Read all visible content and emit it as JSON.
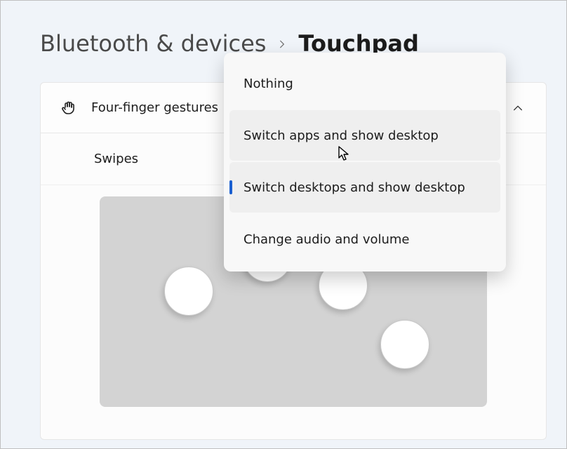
{
  "breadcrumb": {
    "parent": "Bluetooth & devices",
    "current": "Touchpad"
  },
  "card": {
    "title": "Four-finger gestures",
    "subrow_label": "Swipes"
  },
  "popup": {
    "items": [
      {
        "label": "Nothing"
      },
      {
        "label": "Switch apps and show desktop"
      },
      {
        "label": "Switch desktops and show desktop"
      },
      {
        "label": "Change audio and volume"
      }
    ]
  }
}
